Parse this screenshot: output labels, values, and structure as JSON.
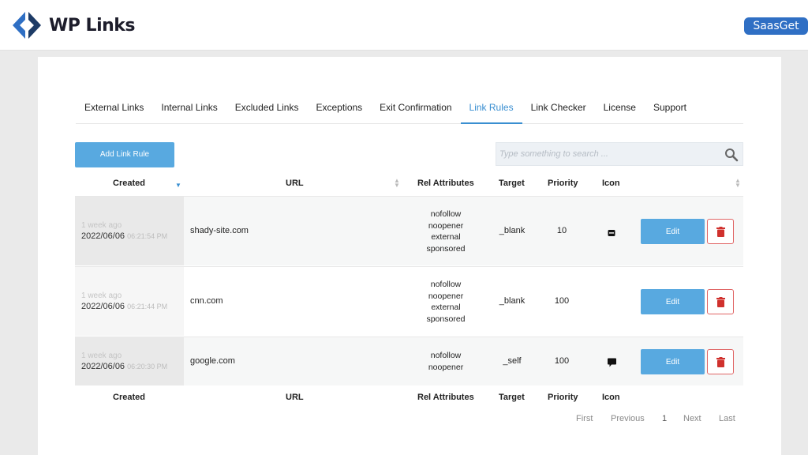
{
  "brand": {
    "name": "WP Links",
    "badge": "SaasGet"
  },
  "tabs": [
    {
      "label": "External Links"
    },
    {
      "label": "Internal Links"
    },
    {
      "label": "Excluded Links"
    },
    {
      "label": "Exceptions"
    },
    {
      "label": "Exit Confirmation"
    },
    {
      "label": "Link Rules",
      "active": true
    },
    {
      "label": "Link Checker"
    },
    {
      "label": "License"
    },
    {
      "label": "Support"
    }
  ],
  "toolbar": {
    "add_label": "Add Link Rule",
    "search_placeholder": "Type something to search ..."
  },
  "table": {
    "columns": [
      "Created",
      "URL",
      "Rel Attributes",
      "Target",
      "Priority",
      "Icon"
    ],
    "rows": [
      {
        "ago": "1 week ago",
        "date": "2022/06/06",
        "time": "06:21:54 PM",
        "url": "shady-site.com",
        "rel": [
          "nofollow",
          "noopener",
          "external",
          "sponsored"
        ],
        "target": "_blank",
        "priority": "10",
        "icon": "square-icon",
        "edit": "Edit"
      },
      {
        "ago": "1 week ago",
        "date": "2022/06/06",
        "time": "06:21:44 PM",
        "url": "cnn.com",
        "rel": [
          "nofollow",
          "noopener",
          "external",
          "sponsored"
        ],
        "target": "_blank",
        "priority": "100",
        "icon": "none",
        "edit": "Edit"
      },
      {
        "ago": "1 week ago",
        "date": "2022/06/06",
        "time": "06:20:30 PM",
        "url": "google.com",
        "rel": [
          "nofollow",
          "noopener"
        ],
        "target": "_self",
        "priority": "100",
        "icon": "comment-icon",
        "edit": "Edit"
      }
    ]
  },
  "pagination": {
    "first": "First",
    "previous": "Previous",
    "page": "1",
    "next": "Next",
    "last": "Last"
  },
  "colors": {
    "accent": "#58a9e0",
    "active_tab": "#3a8fd1",
    "delete": "#d0312d",
    "badge": "#2f6fc4"
  }
}
